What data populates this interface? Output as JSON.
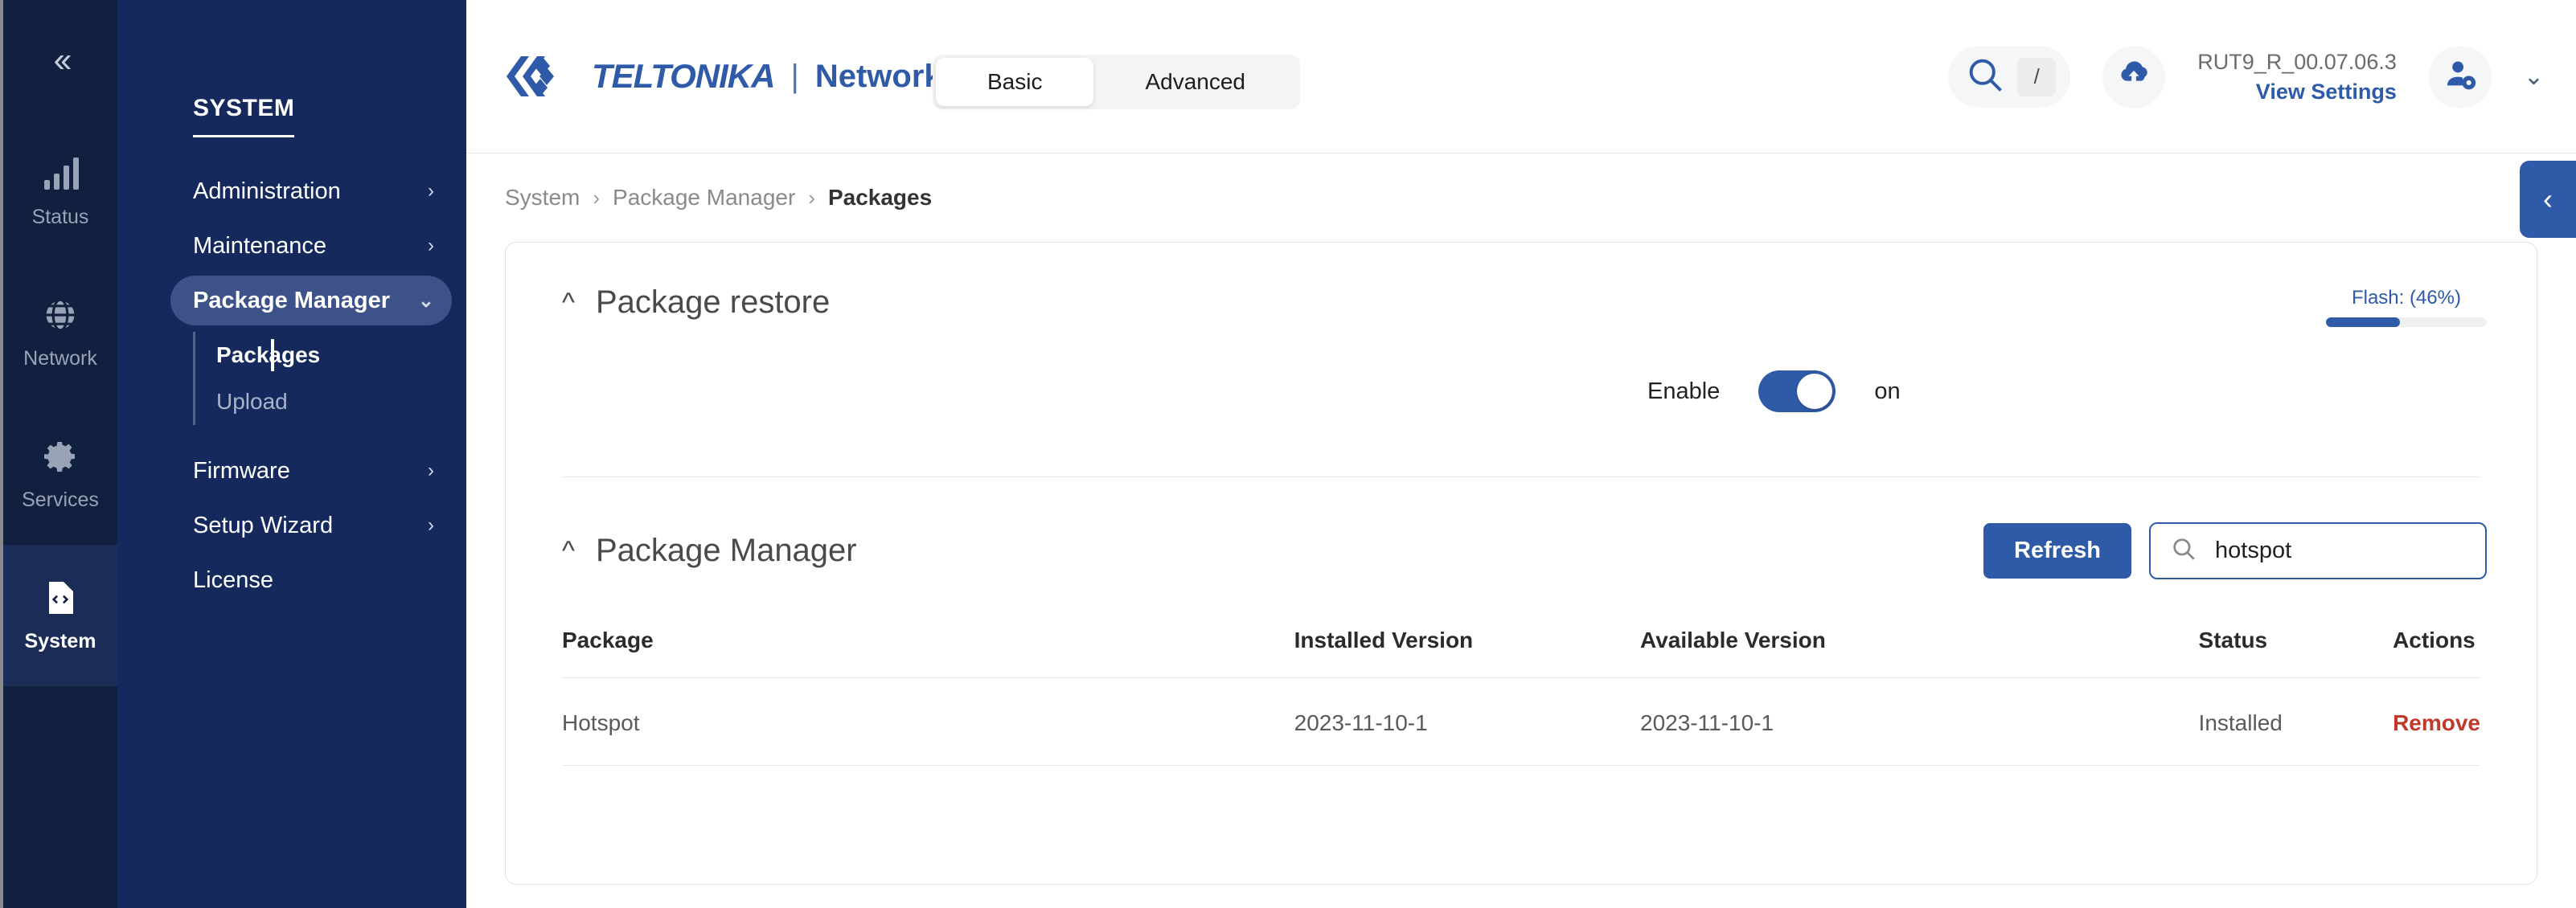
{
  "rail": {
    "collapse_icon": "double-chevron-left",
    "items": [
      {
        "label": "Status",
        "icon": "signal-bars-icon",
        "active": false
      },
      {
        "label": "Network",
        "icon": "globe-icon",
        "active": false
      },
      {
        "label": "Services",
        "icon": "gear-icon",
        "active": false
      },
      {
        "label": "System",
        "icon": "file-code-icon",
        "active": true
      }
    ]
  },
  "subnav": {
    "title": "SYSTEM",
    "items": [
      {
        "label": "Administration",
        "chevron": "›",
        "selected": false
      },
      {
        "label": "Maintenance",
        "chevron": "›",
        "selected": false
      },
      {
        "label": "Package Manager",
        "chevron": "⌄",
        "selected": true
      }
    ],
    "sub_items": [
      {
        "label": "Packages",
        "active": true
      },
      {
        "label": "Upload",
        "active": false
      }
    ],
    "items_after": [
      {
        "label": "Firmware",
        "chevron": "›",
        "selected": false
      },
      {
        "label": "Setup Wizard",
        "chevron": "›",
        "selected": false
      },
      {
        "label": "License",
        "chevron": "",
        "selected": false
      }
    ]
  },
  "header": {
    "brand": "TELTONIKA",
    "brand_divider": "|",
    "brand_sub": "Networks",
    "mode": {
      "basic": "Basic",
      "advanced": "Advanced",
      "active": "Basic"
    },
    "search_shortcut": "/",
    "search_icon": "magnifier-icon",
    "cloud_icon": "cloud-upload-icon",
    "firmware_version": "RUT9_R_00.07.06.3",
    "view_settings": "View Settings",
    "user_icon": "user-gear-icon",
    "user_chevron": "⌄",
    "drawer_chevron": "‹"
  },
  "breadcrumb": {
    "items": [
      "System",
      "Package Manager",
      "Packages"
    ],
    "separator": "›"
  },
  "package_restore": {
    "title": "Package restore",
    "caret": "^",
    "enable_label": "Enable",
    "toggle_state": "on",
    "toggle_on": true
  },
  "flash": {
    "label": "Flash: (46%)",
    "percent": 46,
    "color": "#2e5aa8"
  },
  "package_manager": {
    "title": "Package Manager",
    "caret": "^",
    "refresh_label": "Refresh",
    "search_value": "hotspot",
    "search_placeholder": "",
    "search_icon": "magnifier-icon",
    "columns": [
      "Package",
      "Installed Version",
      "Available Version",
      "Status",
      "Actions"
    ],
    "rows": [
      {
        "package": "Hotspot",
        "installed_version": "2023-11-10-1",
        "available_version": "2023-11-10-1",
        "status": "Installed",
        "action": "Remove"
      }
    ]
  }
}
